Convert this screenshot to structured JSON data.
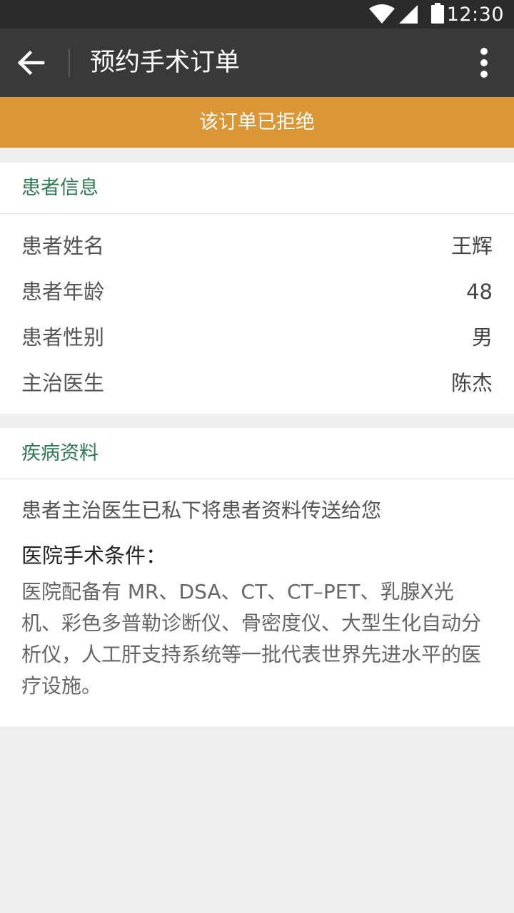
{
  "status_bar": {
    "time": "12:30",
    "icons": [
      "wifi-icon",
      "cell-signal-icon",
      "battery-icon"
    ]
  },
  "app_bar": {
    "title": "预约手术订单",
    "back_icon": "arrow-left-icon",
    "menu_icon": "more-vertical-icon"
  },
  "banner": {
    "text": "该订单已拒绝",
    "color": "#db9636"
  },
  "patient_info": {
    "header": "患者信息",
    "rows": [
      {
        "label": "患者姓名",
        "value": "王辉"
      },
      {
        "label": "患者年龄",
        "value": "48"
      },
      {
        "label": "患者性别",
        "value": "男"
      },
      {
        "label": "主治医生",
        "value": "陈杰"
      }
    ]
  },
  "disease_info": {
    "header": "疾病资料",
    "notice": "患者主治医生已私下将患者资料传送给您",
    "conditions_title": "医院手术条件：",
    "conditions_text": "医院配备有 MR、DSA、CT、CT–PET、乳腺X光机、彩色多普勒诊断仪、骨密度仪、大型生化自动分析仪，人工肝支持系统等一批代表世界先进水平的医疗设施。"
  },
  "colors": {
    "status_bar": "#2b2b2b",
    "app_bar": "#393939",
    "section_header": "#2f7a53",
    "page_bg": "#efefef"
  }
}
